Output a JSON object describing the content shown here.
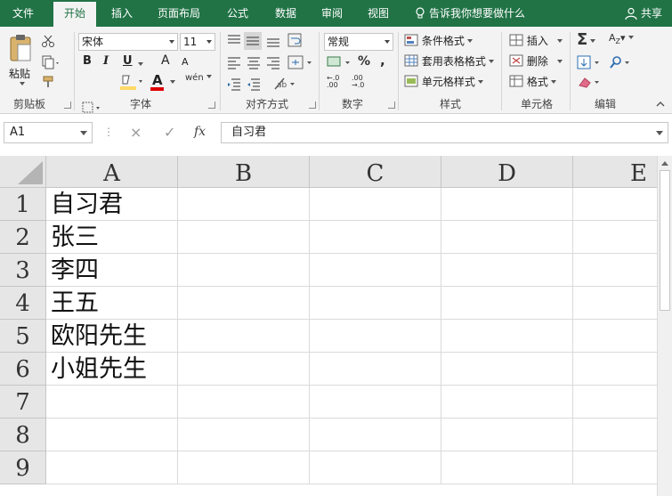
{
  "tabs": [
    {
      "label": "文件",
      "active": false
    },
    {
      "label": "开始",
      "active": true
    },
    {
      "label": "插入",
      "active": false
    },
    {
      "label": "页面布局",
      "active": false
    },
    {
      "label": "公式",
      "active": false
    },
    {
      "label": "数据",
      "active": false
    },
    {
      "label": "审阅",
      "active": false
    },
    {
      "label": "视图",
      "active": false
    }
  ],
  "tell_me": "告诉我你想要做什么",
  "share": "共享",
  "ribbon": {
    "clipboard": {
      "label": "剪贴板",
      "paste": "粘贴"
    },
    "font": {
      "label": "字体",
      "name": "宋体",
      "size": "11",
      "bold": "B",
      "italic": "I",
      "underline": "U",
      "grow": "A",
      "shrink": "A",
      "color_font": "#e00000",
      "color_fill": "#ffd966"
    },
    "alignment": {
      "label": "对齐方式"
    },
    "number": {
      "label": "数字",
      "format": "常规"
    },
    "styles": {
      "label": "样式",
      "conditional": "条件格式",
      "table": "套用表格格式",
      "cell": "单元格样式"
    },
    "cells": {
      "label": "单元格",
      "insert": "插入",
      "delete": "删除",
      "format": "格式"
    },
    "editing": {
      "label": "编辑"
    }
  },
  "formula_bar": {
    "name_box": "A1",
    "cancel": "×",
    "enter": "✓",
    "fx": "fx",
    "content": "自习君"
  },
  "grid": {
    "columns": [
      "A",
      "B",
      "C",
      "D",
      "E"
    ],
    "rows": [
      "1",
      "2",
      "3",
      "4",
      "5",
      "6",
      "7",
      "8",
      "9"
    ],
    "cells": [
      [
        "自习君",
        "",
        "",
        "",
        ""
      ],
      [
        "张三",
        "",
        "",
        "",
        ""
      ],
      [
        "李四",
        "",
        "",
        "",
        ""
      ],
      [
        "王五",
        "",
        "",
        "",
        ""
      ],
      [
        "欧阳先生",
        "",
        "",
        "",
        ""
      ],
      [
        "小姐先生",
        "",
        "",
        "",
        ""
      ],
      [
        "",
        "",
        "",
        "",
        ""
      ],
      [
        "",
        "",
        "",
        "",
        ""
      ],
      [
        "",
        "",
        "",
        "",
        ""
      ]
    ]
  }
}
